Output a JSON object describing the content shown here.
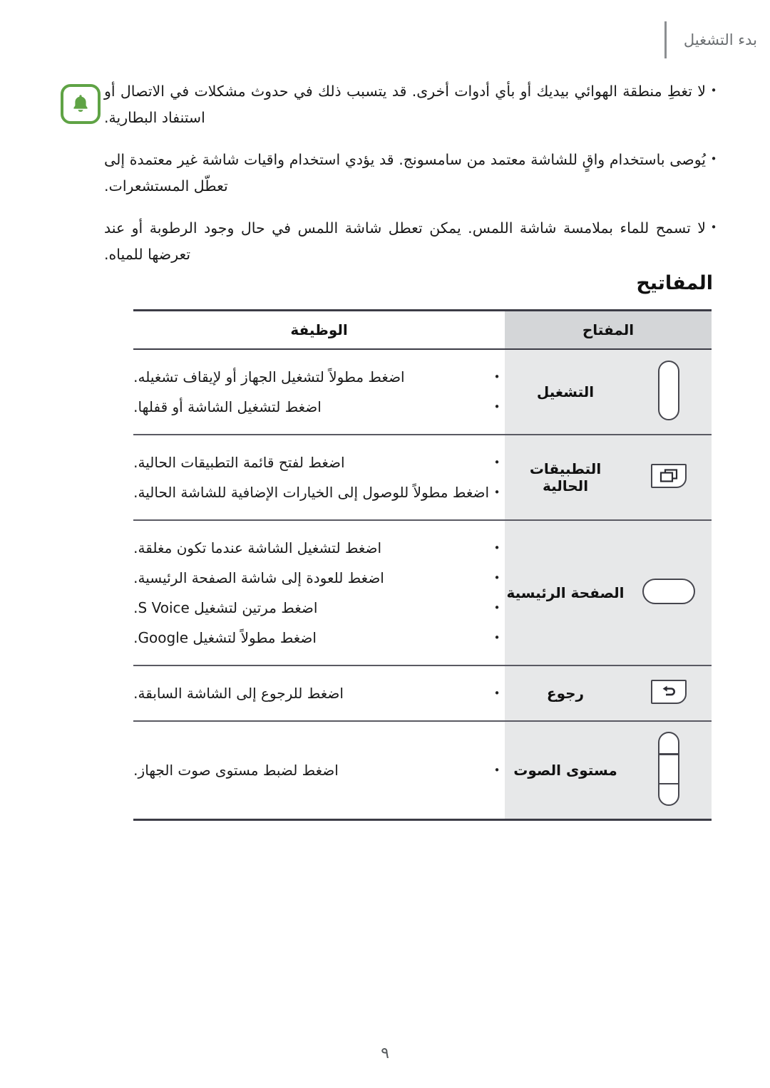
{
  "header": {
    "title": "بدء التشغيل"
  },
  "note": {
    "icon": "notification-bell-icon",
    "accent_color": "#5fa345",
    "bullet": "•",
    "items": [
      "لا تغطِ منطقة الهوائي بيديك أو بأي أدوات أخرى. قد يتسبب ذلك في حدوث مشكلات في الاتصال أو استنفاد البطارية.",
      "يُوصى باستخدام واقٍ للشاشة معتمد من سامسونج. قد يؤدي استخدام واقيات شاشة غير معتمدة إلى تعطّل المستشعرات.",
      "لا تسمح للماء بملامسة شاشة اللمس. يمكن تعطل شاشة اللمس في حال وجود الرطوبة أو عند تعرضها للمياه."
    ]
  },
  "section": {
    "heading": "المفاتيح"
  },
  "table": {
    "headers": {
      "key": "المفتاح",
      "function": "الوظيفة"
    },
    "bullet": "•",
    "rows": [
      {
        "icon": "power-key-icon",
        "label": "التشغيل",
        "functions": [
          "اضغط مطولاً لتشغيل الجهاز أو لإيقاف تشغيله.",
          "اضغط لتشغيل الشاشة أو قفلها."
        ]
      },
      {
        "icon": "recent-apps-key-icon",
        "label": "التطبيقات الحالية",
        "functions": [
          "اضغط لفتح قائمة التطبيقات الحالية.",
          "اضغط مطولاً للوصول إلى الخيارات الإضافية للشاشة الحالية."
        ]
      },
      {
        "icon": "home-key-icon",
        "label": "الصفحة الرئيسية",
        "functions": [
          "اضغط لتشغيل الشاشة عندما تكون مغلقة.",
          "اضغط للعودة إلى شاشة الصفحة الرئيسية.",
          "اضغط مرتين لتشغيل S Voice.",
          "اضغط مطولاً لتشغيل Google."
        ]
      },
      {
        "icon": "back-key-icon",
        "label": "رجوع",
        "functions": [
          "اضغط للرجوع إلى الشاشة السابقة."
        ]
      },
      {
        "icon": "volume-key-icon",
        "label": "مستوى الصوت",
        "functions": [
          "اضغط لضبط مستوى صوت الجهاز."
        ]
      }
    ]
  },
  "footer": {
    "page_number": "٩"
  }
}
